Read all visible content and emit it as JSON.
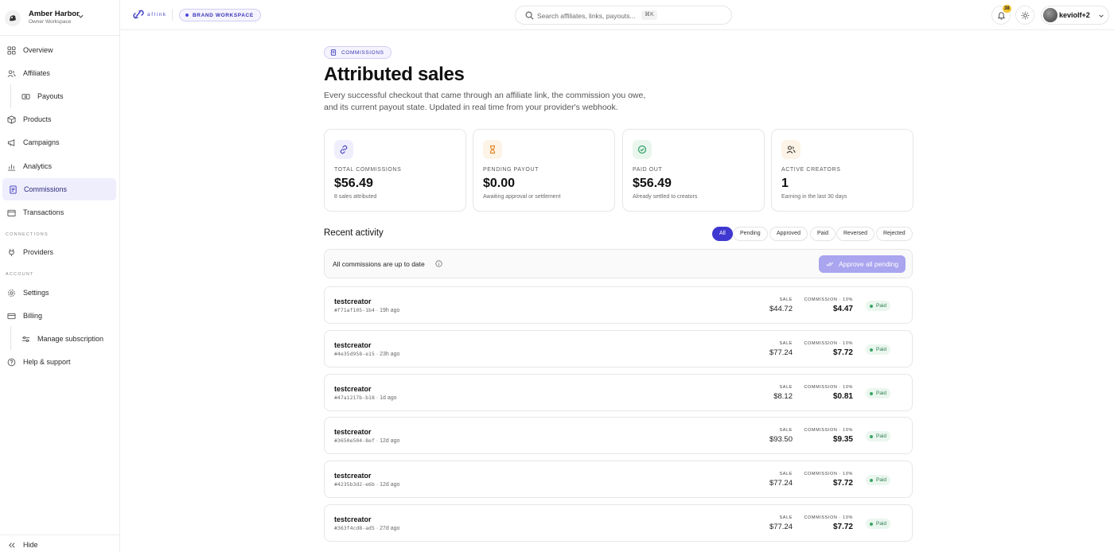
{
  "workspace": {
    "name": "Amber Harbor",
    "role": "Owner Workspace"
  },
  "sidebar": {
    "items": [
      {
        "label": "Overview"
      },
      {
        "label": "Affiliates"
      },
      {
        "label": "Payouts"
      },
      {
        "label": "Products"
      },
      {
        "label": "Campaigns"
      },
      {
        "label": "Analytics"
      },
      {
        "label": "Commissions"
      },
      {
        "label": "Transactions"
      }
    ],
    "connections_label": "CONNECTIONS",
    "providers": "Providers",
    "account_label": "ACCOUNT",
    "settings": "Settings",
    "billing": "Billing",
    "manage_subscription": "Manage subscription",
    "help": "Help & support",
    "hide": "Hide"
  },
  "topbar": {
    "logo_text": "aflink",
    "brand_pill": "BRAND WORKSPACE",
    "search_placeholder": "Search affiliates, links, payouts...",
    "search_shortcut": "⌘K",
    "notifications_count": "38",
    "user_name": "keviolf+2"
  },
  "page": {
    "tag": "COMMISSIONS",
    "title": "Attributed sales",
    "description": "Every successful checkout that came through an affiliate link, the commission you owe, and its current payout state. Updated in real time from your provider's webhook."
  },
  "stats": [
    {
      "label": "TOTAL COMMISSIONS",
      "value": "$56.49",
      "sub": "8 sales attributed",
      "icon": "link-icon",
      "color": "#4b47c4",
      "bg": "#efeefd"
    },
    {
      "label": "PENDING PAYOUT",
      "value": "$0.00",
      "sub": "Awaiting approval or settlement",
      "icon": "hourglass-icon",
      "color": "#e0892a",
      "bg": "#fdf3e6"
    },
    {
      "label": "PAID OUT",
      "value": "$56.49",
      "sub": "Already settled to creators",
      "icon": "check-circle-icon",
      "color": "#2f9e63",
      "bg": "#e8f6ee"
    },
    {
      "label": "ACTIVE CREATORS",
      "value": "1",
      "sub": "Earning in the last 30 days",
      "icon": "users-icon",
      "color": "#444",
      "bg": "#fdf3e6"
    }
  ],
  "activity": {
    "title": "Recent activity",
    "filters": [
      "All",
      "Pending",
      "Approved",
      "Paid",
      "Reversed",
      "Rejected"
    ],
    "active_filter": "All",
    "banner_text": "All commissions are up to date",
    "approve_label": "Approve all pending",
    "sale_label": "SALE",
    "rows": [
      {
        "name": "testcreator",
        "id": "#f71af105-1b4",
        "time": "19h ago",
        "sale": "$44.72",
        "commission_label": "COMMISSION · 10%",
        "commission": "$4.47",
        "status": "Paid"
      },
      {
        "name": "testcreator",
        "id": "#4e35d958-e15",
        "time": "23h ago",
        "sale": "$77.24",
        "commission_label": "COMMISSION · 10%",
        "commission": "$7.72",
        "status": "Paid"
      },
      {
        "name": "testcreator",
        "id": "#47a1217b-b18",
        "time": "1d ago",
        "sale": "$8.12",
        "commission_label": "COMMISSION · 10%",
        "commission": "$0.81",
        "status": "Paid"
      },
      {
        "name": "testcreator",
        "id": "#3650e504-8ef",
        "time": "12d ago",
        "sale": "$93.50",
        "commission_label": "COMMISSION · 10%",
        "commission": "$9.35",
        "status": "Paid"
      },
      {
        "name": "testcreator",
        "id": "#4235b3d2-e6b",
        "time": "12d ago",
        "sale": "$77.24",
        "commission_label": "COMMISSION · 10%",
        "commission": "$7.72",
        "status": "Paid"
      },
      {
        "name": "testcreator",
        "id": "#363f4cd8-ad5",
        "time": "27d ago",
        "sale": "$77.24",
        "commission_label": "COMMISSION · 10%",
        "commission": "$7.72",
        "status": "Paid"
      }
    ]
  }
}
